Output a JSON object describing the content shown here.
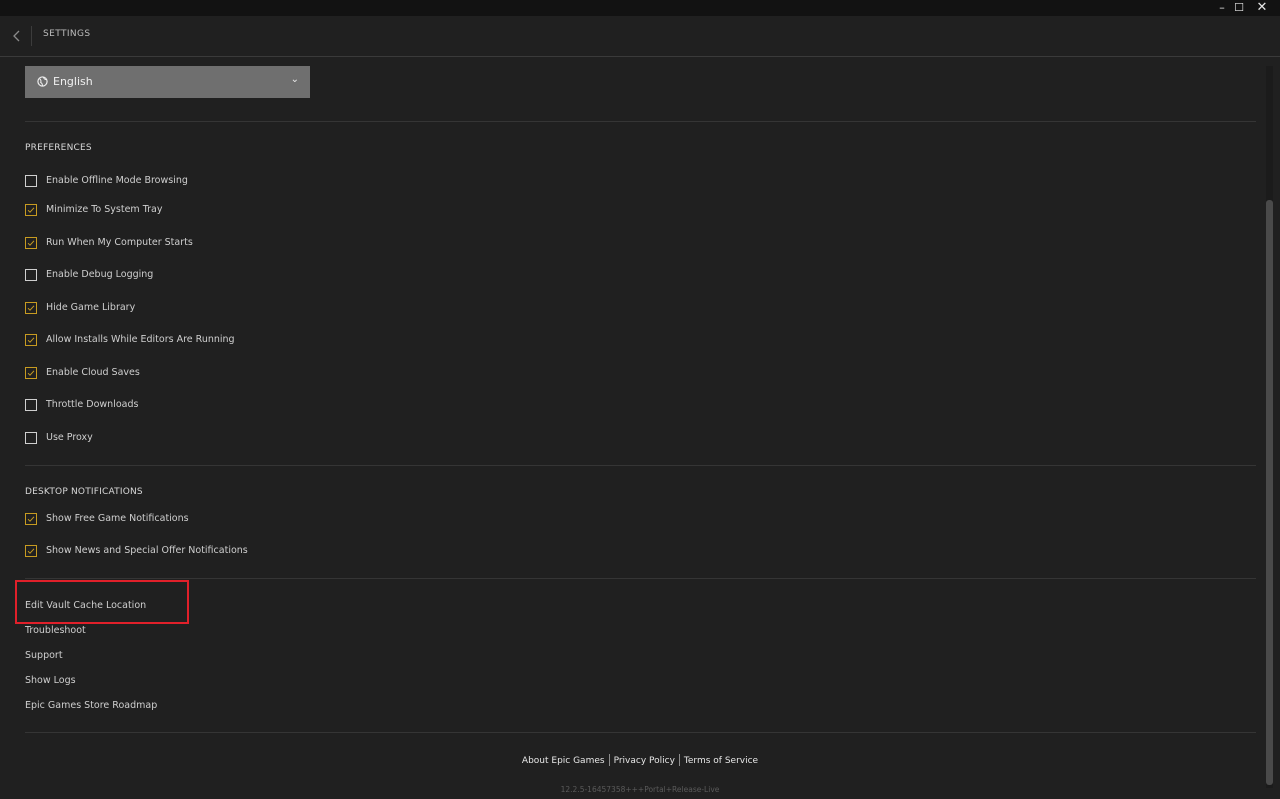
{
  "header": {
    "title": "SETTINGS"
  },
  "language": {
    "selected": "English"
  },
  "preferences": {
    "title": "PREFERENCES",
    "items": [
      {
        "label": "Enable Offline Mode Browsing",
        "checked": false
      },
      {
        "label": "Minimize To System Tray",
        "checked": true
      },
      {
        "label": "Run When My Computer Starts",
        "checked": true
      },
      {
        "label": "Enable Debug Logging",
        "checked": false
      },
      {
        "label": "Hide Game Library",
        "checked": true
      },
      {
        "label": "Allow Installs While Editors Are Running",
        "checked": true
      },
      {
        "label": "Enable Cloud Saves",
        "checked": true
      },
      {
        "label": "Throttle Downloads",
        "checked": false
      },
      {
        "label": "Use Proxy",
        "checked": false
      }
    ]
  },
  "notifications": {
    "title": "DESKTOP NOTIFICATIONS",
    "items": [
      {
        "label": "Show Free Game Notifications",
        "checked": true
      },
      {
        "label": "Show News and Special Offer Notifications",
        "checked": true
      }
    ]
  },
  "links": {
    "edit_vault": "Edit Vault Cache Location",
    "troubleshoot": "Troubleshoot",
    "support": "Support",
    "show_logs": "Show Logs",
    "roadmap": "Epic Games Store Roadmap"
  },
  "footer": {
    "about": "About Epic Games",
    "privacy": "Privacy Policy",
    "terms": "Terms of Service",
    "version": "12.2.5-16457358+++Portal+Release-Live"
  },
  "colors": {
    "accent": "#c79b21",
    "highlight": "#e0202a"
  }
}
